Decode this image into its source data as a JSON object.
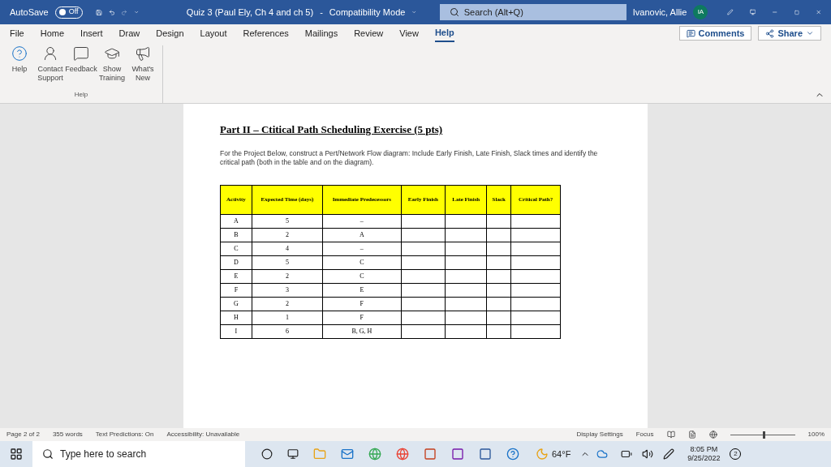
{
  "titlebar": {
    "autosave": "AutoSave",
    "autosave_toggle": {
      "label": "Off",
      "on": false
    },
    "doc_title": "Quiz 3 (Paul Ely, Ch 4 and ch 5)",
    "separator": "-",
    "mode": "Compatibility Mode",
    "search": {
      "placeholder": "Search (Alt+Q)"
    },
    "user": "Ivanovic, Allie",
    "initials": "IA"
  },
  "tabs": [
    {
      "label": "File",
      "selected": false
    },
    {
      "label": "Home",
      "selected": false
    },
    {
      "label": "Insert",
      "selected": false
    },
    {
      "label": "Draw",
      "selected": false
    },
    {
      "label": "Design",
      "selected": false
    },
    {
      "label": "Layout",
      "selected": false
    },
    {
      "label": "References",
      "selected": false
    },
    {
      "label": "Mailings",
      "selected": false
    },
    {
      "label": "Review",
      "selected": false
    },
    {
      "label": "View",
      "selected": false
    },
    {
      "label": "Help",
      "selected": true
    }
  ],
  "comments": "Comments",
  "share": "Share",
  "ribbon": {
    "group": "Help",
    "buttons": [
      {
        "kind": "help",
        "label": "Help"
      },
      {
        "kind": "contact",
        "label": "Contact Support"
      },
      {
        "kind": "feedback",
        "label": "Feedback"
      },
      {
        "kind": "training",
        "label": "Show Training"
      },
      {
        "kind": "new",
        "label": "What's New"
      }
    ]
  },
  "document": {
    "heading": "Part II – Ctitical Path Scheduling Exercise (5 pts)",
    "instructions": "For the Project Below, construct a Pert/Network Flow diagram: Include Early Finish, Late Finish, Slack times and identify the critical path (both in the table and on the diagram).",
    "table": {
      "columns": [
        "Activity",
        "Expected Time (days)",
        "Immediate Predecessors",
        "Early Finish",
        "Late Finish",
        "Slack",
        "Critical Path?"
      ],
      "rows": [
        [
          "A",
          "5",
          "–"
        ],
        [
          "B",
          "2",
          "A"
        ],
        [
          "C",
          "4",
          "–"
        ],
        [
          "D",
          "5",
          "C"
        ],
        [
          "E",
          "2",
          "C"
        ],
        [
          "F",
          "3",
          "E"
        ],
        [
          "G",
          "2",
          "F"
        ],
        [
          "H",
          "1",
          "F"
        ],
        [
          "I",
          "6",
          "B, G, H"
        ]
      ]
    }
  },
  "status_bar": {
    "left": [
      "Page 2 of 2",
      "355 words"
    ],
    "predictions": "Text Predictions: On",
    "accessibility": "Accessibility: Unavailable",
    "display": "Display Settings",
    "focus": "Focus",
    "zoom_slider": {
      "level": 0.5
    },
    "zoom": "100%"
  },
  "taskbar": {
    "search_placeholder": "Type here to search",
    "weather": "64°F",
    "time": "8:05 PM",
    "date": "9/25/2022",
    "notifications": "2"
  }
}
